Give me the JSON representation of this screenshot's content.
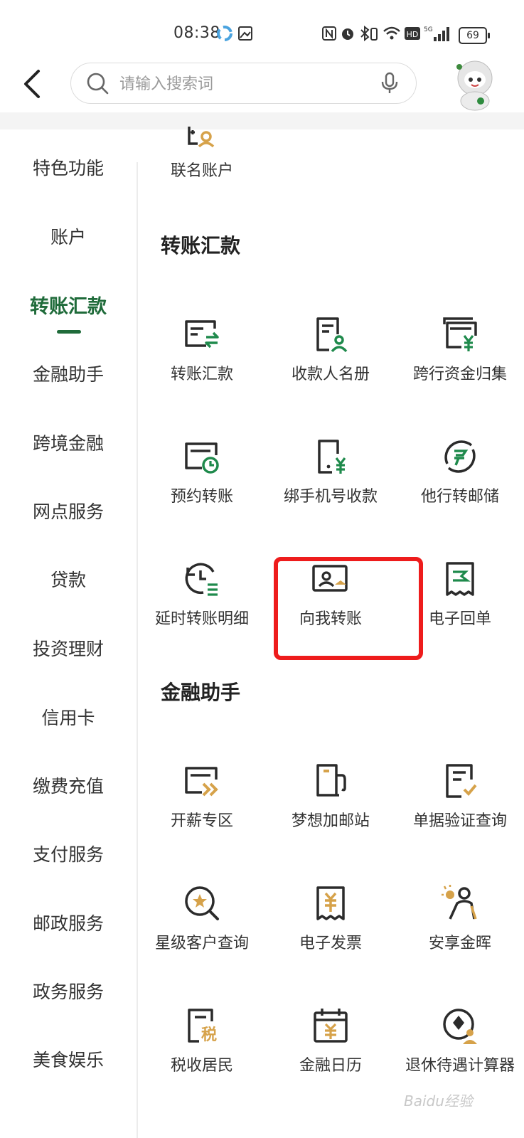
{
  "status_bar": {
    "time": "08:38",
    "battery": "69"
  },
  "search": {
    "placeholder": "请输入搜索词"
  },
  "sidebar": {
    "items": [
      {
        "label": "特色功能"
      },
      {
        "label": "账户"
      },
      {
        "label": "转账汇款",
        "active": true
      },
      {
        "label": "金融助手"
      },
      {
        "label": "跨境金融"
      },
      {
        "label": "网点服务"
      },
      {
        "label": "贷款"
      },
      {
        "label": "投资理财"
      },
      {
        "label": "信用卡"
      },
      {
        "label": "缴费充值"
      },
      {
        "label": "支付服务"
      },
      {
        "label": "邮政服务"
      },
      {
        "label": "政务服务"
      },
      {
        "label": "美食娱乐"
      }
    ]
  },
  "top_tile": {
    "label": "联名账户",
    "icon": "joint-account-icon"
  },
  "sections": [
    {
      "title": "转账汇款",
      "tiles": [
        {
          "label": "转账汇款",
          "icon": "transfer-icon"
        },
        {
          "label": "收款人名册",
          "icon": "payee-list-icon"
        },
        {
          "label": "跨行资金归集",
          "icon": "fund-collection-icon"
        },
        {
          "label": "预约转账",
          "icon": "scheduled-transfer-icon"
        },
        {
          "label": "绑手机号收款",
          "icon": "phone-receive-icon"
        },
        {
          "label": "他行转邮储",
          "icon": "other-bank-transfer-icon"
        },
        {
          "label": "延时转账明细",
          "icon": "delayed-transfer-icon"
        },
        {
          "label": "向我转账",
          "icon": "transfer-to-me-icon"
        },
        {
          "label": "电子回单",
          "icon": "e-receipt-icon"
        }
      ]
    },
    {
      "title": "金融助手",
      "tiles": [
        {
          "label": "开薪专区",
          "icon": "salary-zone-icon"
        },
        {
          "label": "梦想加邮站",
          "icon": "dream-station-icon"
        },
        {
          "label": "单据验证查询",
          "icon": "document-verify-icon"
        },
        {
          "label": "星级客户查询",
          "icon": "star-customer-icon"
        },
        {
          "label": "电子发票",
          "icon": "e-invoice-icon"
        },
        {
          "label": "安享金晖",
          "icon": "senior-service-icon"
        },
        {
          "label": "税收居民",
          "icon": "tax-resident-icon"
        },
        {
          "label": "金融日历",
          "icon": "finance-calendar-icon"
        },
        {
          "label": "退休待遇计算器",
          "icon": "pension-calculator-icon"
        }
      ]
    }
  ],
  "watermark": "Baidu经验",
  "colors": {
    "accent": "#1f6b3a",
    "icon_dark": "#2b2b2b",
    "icon_green": "#1f8a4c",
    "icon_gold": "#d6a24a",
    "highlight": "#ee1c1c"
  }
}
